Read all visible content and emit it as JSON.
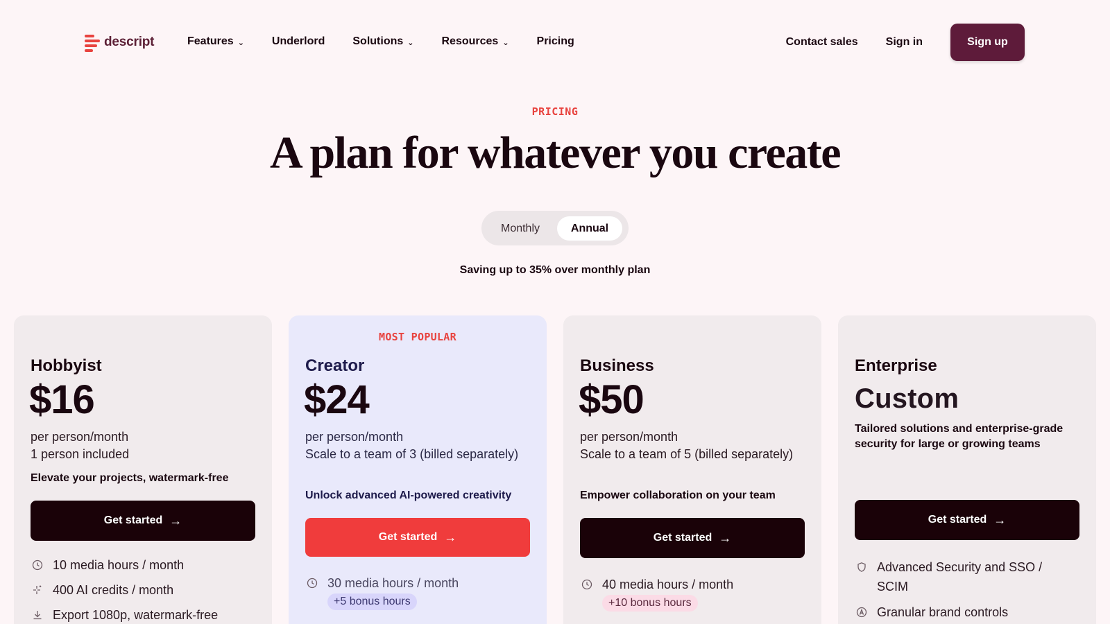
{
  "nav": {
    "logo_text": "descript",
    "links": [
      {
        "label": "Features",
        "has_dropdown": true
      },
      {
        "label": "Underlord",
        "has_dropdown": false
      },
      {
        "label": "Solutions",
        "has_dropdown": true
      },
      {
        "label": "Resources",
        "has_dropdown": true
      },
      {
        "label": "Pricing",
        "has_dropdown": false
      }
    ],
    "contact_sales": "Contact sales",
    "sign_in": "Sign in",
    "sign_up": "Sign up"
  },
  "hero": {
    "eyebrow": "PRICING",
    "headline": "A plan for whatever you create",
    "toggle": {
      "monthly": "Monthly",
      "annual": "Annual",
      "selected": "Annual"
    },
    "saving": "Saving up to 35% over monthly plan"
  },
  "colors": {
    "accent": "#e8433f",
    "brand": "#5e1b3a",
    "background": "#fdf5f7",
    "creator_card": "#e9e9fb"
  },
  "plans": [
    {
      "name": "Hobbyist",
      "price": "$16",
      "sub_lines": [
        "per person/month",
        "1 person included"
      ],
      "tagline": "Elevate your projects, watermark-free",
      "cta": "Get started",
      "features": [
        {
          "icon": "clock-icon",
          "text": "10 media hours / month"
        },
        {
          "icon": "sparkle-icon",
          "text": "400 AI credits / month"
        },
        {
          "icon": "download-icon",
          "text": "Export 1080p, watermark-free"
        }
      ]
    },
    {
      "name": "Creator",
      "badge": "MOST POPULAR",
      "price": "$24",
      "sub_lines": [
        "per person/month",
        "Scale to a team of 3 (billed separately)"
      ],
      "tagline": "Unlock advanced AI-powered creativity",
      "cta": "Get started",
      "features": [
        {
          "icon": "clock-icon",
          "text": "30 media hours / month",
          "bonus": "+5 bonus hours"
        }
      ]
    },
    {
      "name": "Business",
      "price": "$50",
      "sub_lines": [
        "per person/month",
        "Scale to a team of 5 (billed separately)"
      ],
      "tagline": "Empower collaboration on your team",
      "cta": "Get started",
      "features": [
        {
          "icon": "clock-icon",
          "text": "40 media hours / month",
          "bonus": "+10 bonus hours"
        }
      ]
    },
    {
      "name": "Enterprise",
      "price": "Custom",
      "tagline": "Tailored solutions and enterprise-grade security for large or growing teams",
      "cta": "Get started",
      "features": [
        {
          "icon": "shield-icon",
          "text": "Advanced Security and SSO / SCIM"
        },
        {
          "icon": "brand-icon",
          "text": "Granular brand controls"
        }
      ]
    }
  ]
}
